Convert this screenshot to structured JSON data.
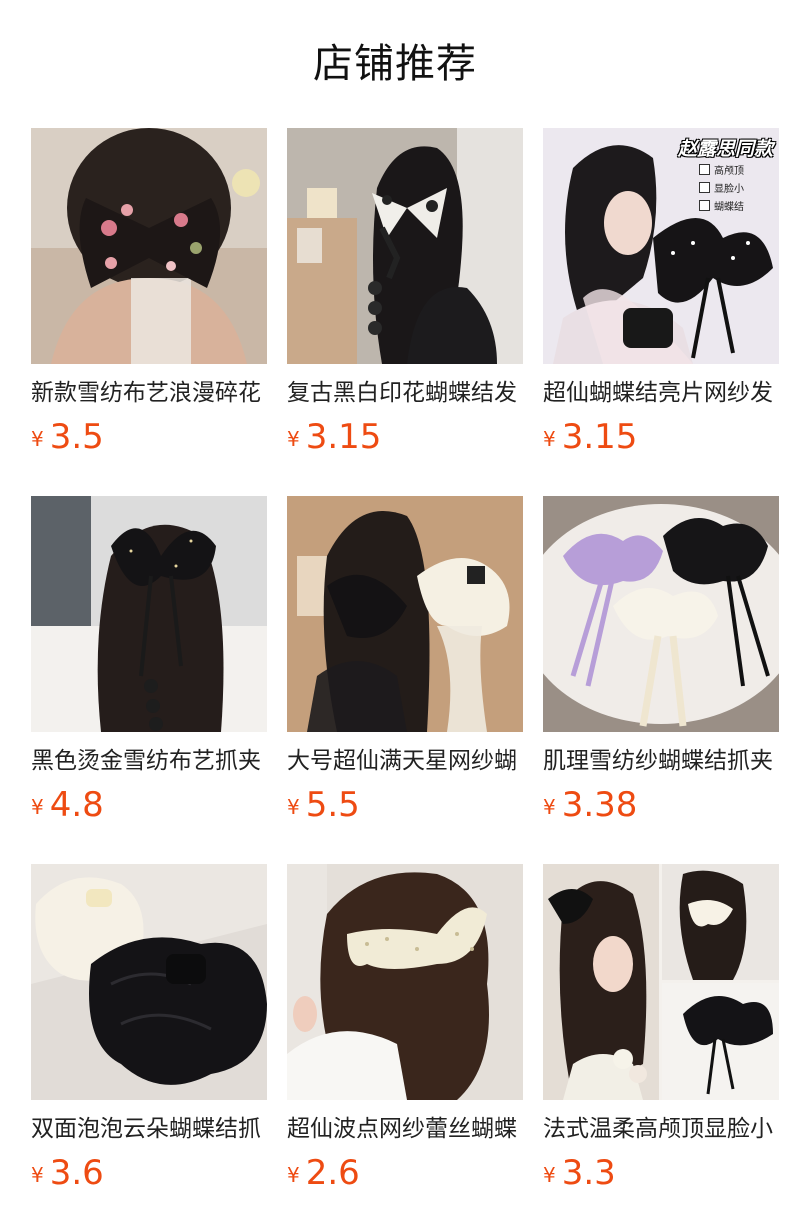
{
  "page": {
    "title": "店铺推荐"
  },
  "currency_symbol": "¥",
  "products": [
    {
      "title": "新款雪纺布艺浪漫碎花",
      "price": "3.5",
      "image": "floral-black-bow-hairclip-photo"
    },
    {
      "title": "复古黑白印花蝴蝶结发",
      "price": "3.15",
      "image": "black-white-print-bow-photo"
    },
    {
      "title": "超仙蝴蝶结亮片网纱发",
      "price": "3.15",
      "image": "sequin-mesh-bow-photo",
      "badge": "赵露思同款",
      "tags": [
        "高颅顶",
        "显脸小",
        "蝴蝶结"
      ]
    },
    {
      "title": "黑色烫金雪纺布艺抓夹",
      "price": "4.8",
      "image": "black-gilded-chiffon-bow-photo"
    },
    {
      "title": "大号超仙满天星网纱蝴",
      "price": "5.5",
      "image": "starry-mesh-bows-photo"
    },
    {
      "title": "肌理雪纺纱蝴蝶结抓夹",
      "price": "3.38",
      "image": "textured-chiffon-bows-photo"
    },
    {
      "title": "双面泡泡云朵蝴蝶结抓",
      "price": "3.6",
      "image": "cloud-bubble-bow-claws-photo"
    },
    {
      "title": "超仙波点网纱蕾丝蝴蝶",
      "price": "2.6",
      "image": "polka-dot-lace-bow-photo"
    },
    {
      "title": "法式温柔高颅顶显脸小",
      "price": "3.3",
      "image": "french-high-crown-bow-collage"
    }
  ]
}
